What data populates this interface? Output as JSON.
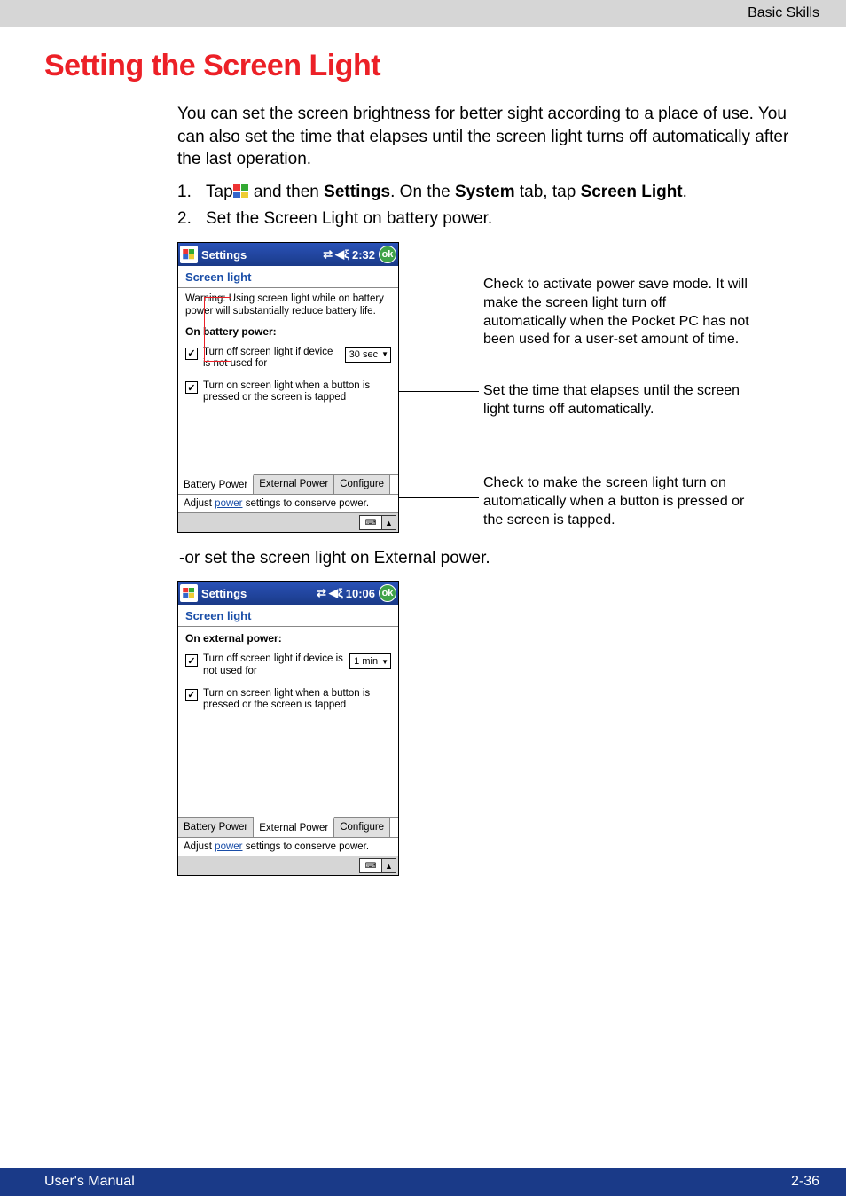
{
  "header": {
    "breadcrumb": "Basic Skills"
  },
  "title": "Setting the Screen Light",
  "intro": "You can set the screen brightness for better sight according to a place of use. You can also set the time that elapses until the screen light turns off automatically after the last operation.",
  "steps": {
    "s1_a": "Tap",
    "s1_b": " and then ",
    "s1_c": "Settings",
    "s1_d": ". On the ",
    "s1_e": "System",
    "s1_f": " tab, tap ",
    "s1_g": "Screen Light",
    "s1_h": ".",
    "s2": "Set the Screen Light on battery power."
  },
  "device1": {
    "title": "Settings",
    "time": "2:32",
    "panel_title": "Screen light",
    "warning": "Warning: Using screen light while on battery power will substantially reduce battery life.",
    "section": "On battery power:",
    "chk1": "Turn off screen light if device is not used for",
    "dd1": "30 sec",
    "chk2": "Turn on screen light when a button is pressed or the screen is tapped",
    "tabs": {
      "t1": "Battery Power",
      "t2": "External Power",
      "t3": "Configure"
    },
    "adjust_a": "Adjust ",
    "adjust_link": "power",
    "adjust_b": " settings to conserve power."
  },
  "annotations": {
    "a1": "Check to activate power save mode. It will make the screen light turn off automatically when the Pocket PC has not been used for a user-set amount of time.",
    "a2": "Set the time that elapses until the screen light turns off automatically.",
    "a3": "Check to make the screen light turn on automatically when a button is pressed or the screen is tapped."
  },
  "between": "-or set the screen light on External power.",
  "device2": {
    "title": "Settings",
    "time": "10:06",
    "panel_title": "Screen light",
    "section": "On external power:",
    "chk1": "Turn off screen light if device is not used for",
    "dd1": "1 min",
    "chk2": "Turn on screen light when a button is pressed or the screen is tapped",
    "tabs": {
      "t1": "Battery Power",
      "t2": "External Power",
      "t3": "Configure"
    },
    "adjust_a": "Adjust ",
    "adjust_link": "power",
    "adjust_b": " settings to conserve power."
  },
  "footer": {
    "left": "User's Manual",
    "right": "2-36"
  }
}
